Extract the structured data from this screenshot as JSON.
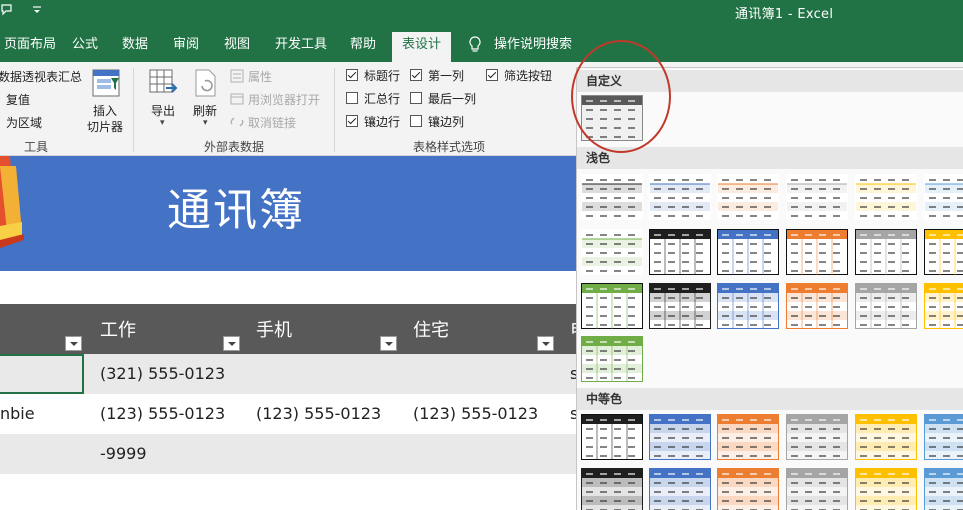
{
  "window": {
    "title": "通讯簿1  -  Excel"
  },
  "tabs": [
    {
      "label": "页面布局",
      "active": false
    },
    {
      "label": "公式",
      "active": false
    },
    {
      "label": "数据",
      "active": false
    },
    {
      "label": "审阅",
      "active": false
    },
    {
      "label": "视图",
      "active": false
    },
    {
      "label": "开发工具",
      "active": false
    },
    {
      "label": "帮助",
      "active": false
    },
    {
      "label": "表设计",
      "active": true
    },
    {
      "label": "操作说明搜索",
      "active": false
    }
  ],
  "ribbon": {
    "tools": {
      "pivot": "数据透视表汇总",
      "remove_dup": "复值",
      "convert": "为区域",
      "slicer_line1": "插入",
      "slicer_line2": "切片器",
      "group": "工具"
    },
    "external": {
      "export": "导出",
      "refresh": "刷新",
      "properties": "属性",
      "open_browser": "用浏览器打开",
      "unlink": "取消链接",
      "group": "外部表数据"
    },
    "style_options": {
      "header_row": {
        "label": "标题行",
        "checked": true
      },
      "total_row": {
        "label": "汇总行",
        "checked": false
      },
      "banded_rows": {
        "label": "镶边行",
        "checked": true
      },
      "first_col": {
        "label": "第一列",
        "checked": true
      },
      "last_col": {
        "label": "最后一列",
        "checked": false
      },
      "banded_cols": {
        "label": "镶边列",
        "checked": false
      },
      "filter_btn": {
        "label": "筛选按钮",
        "checked": true
      },
      "group": "表格样式选项"
    }
  },
  "sheet": {
    "banner_title": "通讯簿",
    "headers": [
      "工作",
      "手机",
      "住宅",
      "电"
    ],
    "rows": [
      {
        "c0": "",
        "c1": "(321) 555-0123",
        "c2": "",
        "c3": "",
        "c4": "s"
      },
      {
        "c0": "nbie",
        "c1": "(123) 555-0123",
        "c2": "(123) 555-0123",
        "c3": "(123) 555-0123",
        "c4": "s"
      },
      {
        "c0": "",
        "c1": "-9999",
        "c2": "",
        "c3": "",
        "c4": ""
      }
    ]
  },
  "gallery": {
    "sections": {
      "custom": "自定义",
      "light": "浅色",
      "medium": "中等色"
    },
    "colors": {
      "black": "#1f1f1f",
      "blue": "#4472c4",
      "orange": "#ed7d31",
      "gray": "#a5a5a5",
      "gold": "#ffc000",
      "lightblue": "#5b9bd5",
      "green": "#70ad47",
      "header_band": "#595959",
      "accent": "#217346"
    }
  }
}
